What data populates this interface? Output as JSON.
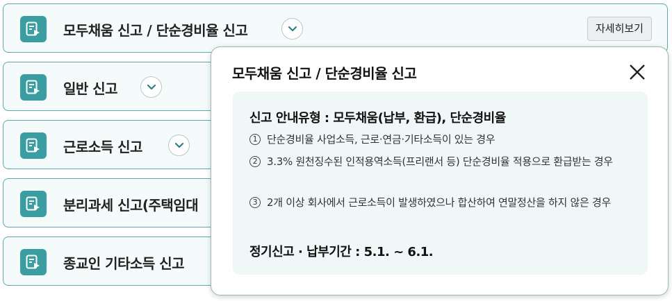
{
  "menu": {
    "items": [
      {
        "label": "모두채움 신고 / 단순경비율 신고",
        "has_toggle": true,
        "detail_label": "자세히보기"
      },
      {
        "label": "일반 신고",
        "has_toggle": true
      },
      {
        "label": "근로소득 신고",
        "has_toggle": true
      },
      {
        "label": "분리과세 신고(주택임대",
        "has_toggle": false
      },
      {
        "label": "종교인 기타소득 신고",
        "has_toggle": false
      }
    ]
  },
  "popup": {
    "title": "모두채움 신고 / 단순경비율 신고",
    "guide_heading": "신고 안내유형 : 모두채움(납부, 환급), 단순경비율",
    "cases": [
      {
        "num": "1",
        "text": "단순경비율 사업소득, 근로·연금·기타소득이 있는 경우"
      },
      {
        "num": "2",
        "text": "3.3% 원천징수된 인적용역소득(프리랜서 등) 단순경비율 적용으로 환급받는 경우"
      },
      {
        "num": "3",
        "text": "2개 이상 회사에서 근로소득이 발생하였으나 합산하여 연말정산을 하지 않은 경우"
      }
    ],
    "period": "정기신고 · 납부기간 : 5.1. ~ 6.1."
  },
  "colors": {
    "accent": "#3a9da2",
    "border": "#5fa9ad",
    "panel": "#eff7f7"
  },
  "icons": {
    "item_icon": "report-document-icon",
    "toggle": "chevron-down-icon",
    "close": "close-icon"
  }
}
